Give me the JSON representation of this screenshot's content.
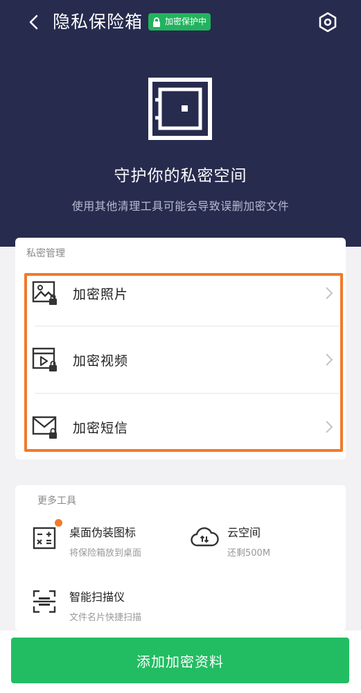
{
  "header": {
    "title": "隐私保险箱",
    "badge": "加密保护中",
    "back_icon": "chevron-left-icon",
    "settings_icon": "hexagon-gear-icon"
  },
  "hero": {
    "title": "守护你的私密空间",
    "subtitle": "使用其他清理工具可能会导致误删加密文件",
    "icon": "safe-icon"
  },
  "private_management": {
    "label": "私密管理",
    "items": [
      {
        "label": "加密照片",
        "icon": "photo-lock-icon"
      },
      {
        "label": "加密视频",
        "icon": "video-lock-icon"
      },
      {
        "label": "加密短信",
        "icon": "message-lock-icon"
      }
    ]
  },
  "more_tools": {
    "label": "更多工具",
    "items": [
      {
        "name": "桌面伪装图标",
        "desc": "将保险箱放到桌面",
        "icon": "calculator-icon",
        "has_dot": true
      },
      {
        "name": "云空间",
        "desc": "还剩500M",
        "icon": "cloud-icon",
        "has_dot": false
      },
      {
        "name": "智能扫描仪",
        "desc": "文件名片快捷扫描",
        "icon": "scanner-icon",
        "has_dot": false
      }
    ]
  },
  "footer": {
    "add_button": "添加加密资料"
  },
  "colors": {
    "header_bg": "#272b4e",
    "accent_green": "#22bd62",
    "highlight_orange": "#f07a2b"
  }
}
